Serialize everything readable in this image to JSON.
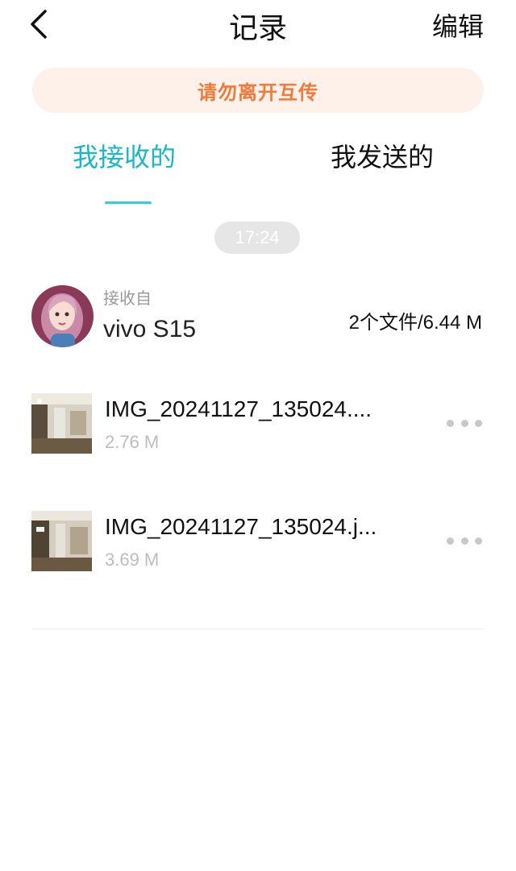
{
  "header": {
    "title": "记录",
    "edit_label": "编辑",
    "back_icon": "back-arrow-icon"
  },
  "banner": {
    "text": "请勿离开互传",
    "color": "#f07a3b",
    "background": "#fdf1ea"
  },
  "tabs": [
    {
      "label": "我接收的",
      "active": true
    },
    {
      "label": "我发送的",
      "active": false
    }
  ],
  "accent_color": "#19b7c7",
  "session": {
    "time": "17:24",
    "from_label": "接收自",
    "device": "vivo S15",
    "summary": "2个文件/6.44 M",
    "files": [
      {
        "name": "IMG_20241127_135024....",
        "size": "2.76 M"
      },
      {
        "name": "IMG_20241127_135024.j...",
        "size": "3.69 M"
      }
    ]
  }
}
